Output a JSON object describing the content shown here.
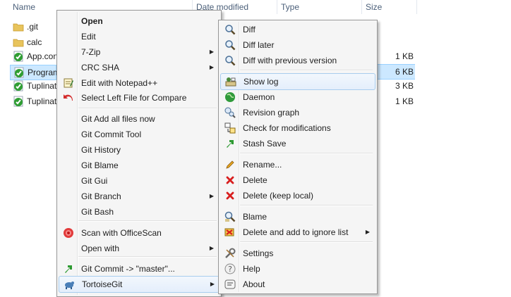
{
  "header": {
    "name": "Name",
    "date_modified": "Date modified",
    "type": "Type",
    "size": "Size"
  },
  "files": [
    {
      "name": ".git",
      "icon": "folder-icon",
      "size": ""
    },
    {
      "name": "calc",
      "icon": "folder-icon",
      "size": ""
    },
    {
      "name": "App.con",
      "icon": "git-file-icon",
      "size": "1 KB"
    },
    {
      "name": "Program",
      "icon": "git-file-icon",
      "size": "6 KB",
      "selected": true
    },
    {
      "name": "Tuplinat",
      "icon": "git-file-icon",
      "size": "3 KB"
    },
    {
      "name": "Tuplinat",
      "icon": "git-file-icon",
      "size": "1 KB"
    }
  ],
  "main_menu": {
    "items": [
      {
        "label": "Open",
        "bold": true
      },
      {
        "label": "Edit"
      },
      {
        "label": "7-Zip",
        "submenu": true
      },
      {
        "label": "CRC SHA",
        "submenu": true
      },
      {
        "label": "Edit with Notepad++",
        "icon": "notepad-icon"
      },
      {
        "label": "Select Left File for Compare",
        "icon": "undo-arrow-icon"
      },
      {
        "label": "Git Add all files now"
      },
      {
        "label": "Git Commit Tool"
      },
      {
        "label": "Git History"
      },
      {
        "label": "Git Blame"
      },
      {
        "label": "Git Gui"
      },
      {
        "label": "Git Branch",
        "submenu": true
      },
      {
        "label": "Git Bash"
      },
      {
        "label": "Scan with OfficeScan",
        "icon": "officescan-icon"
      },
      {
        "label": "Open with",
        "submenu": true
      },
      {
        "label": "Git Commit -> \"master\"...",
        "icon": "commit-arrow-icon"
      },
      {
        "label": "TortoiseGit",
        "icon": "tortoisegit-icon",
        "submenu": true,
        "highlighted": true
      }
    ]
  },
  "tortoise_menu": {
    "items": [
      {
        "label": "Diff",
        "icon": "magnifier-icon"
      },
      {
        "label": "Diff later",
        "icon": "magnifier-icon"
      },
      {
        "label": "Diff with previous version",
        "icon": "magnifier-icon"
      },
      {
        "label": "Show log",
        "icon": "log-icon",
        "highlighted": true
      },
      {
        "label": "Daemon",
        "icon": "globe-icon"
      },
      {
        "label": "Revision graph",
        "icon": "revision-graph-icon"
      },
      {
        "label": "Check for modifications",
        "icon": "check-modifications-icon"
      },
      {
        "label": "Stash Save",
        "icon": "stash-arrow-icon"
      },
      {
        "label": "Rename...",
        "icon": "pencil-icon"
      },
      {
        "label": "Delete",
        "icon": "red-x-icon"
      },
      {
        "label": "Delete (keep local)",
        "icon": "red-x-icon"
      },
      {
        "label": "Blame",
        "icon": "blame-icon"
      },
      {
        "label": "Delete and add to ignore list",
        "icon": "ignore-list-icon",
        "submenu": true
      },
      {
        "label": "Settings",
        "icon": "settings-tools-icon"
      },
      {
        "label": "Help",
        "icon": "help-icon"
      },
      {
        "label": "About",
        "icon": "about-icon"
      }
    ]
  },
  "colors": {
    "selection": "#cce8ff",
    "menu_bg": "#f5f5f5",
    "highlight_border": "#a8cdee"
  }
}
